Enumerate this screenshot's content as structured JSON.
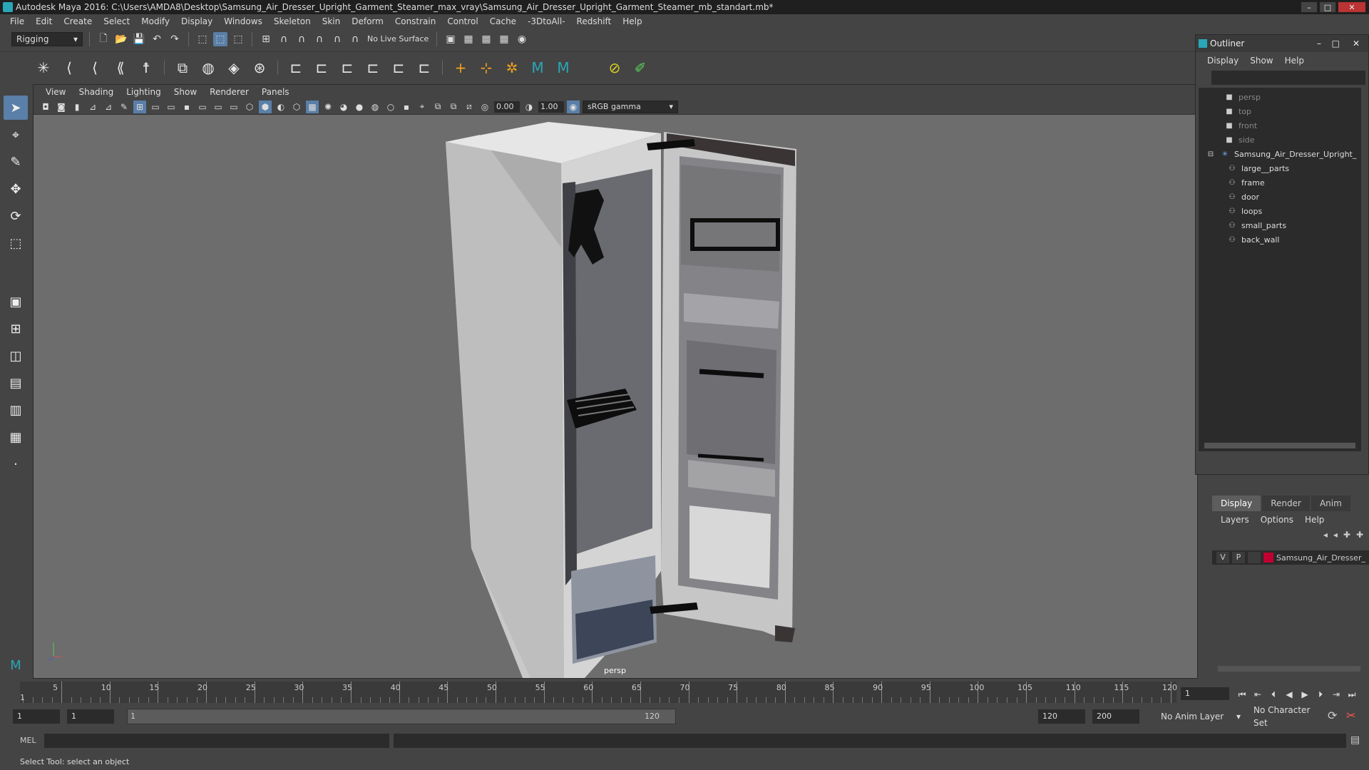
{
  "window": {
    "title": "Autodesk Maya 2016: C:\\Users\\AMDA8\\Desktop\\Samsung_Air_Dresser_Upright_Garment_Steamer_max_vray\\Samsung_Air_Dresser_Upright_Garment_Steamer_mb_standart.mb*"
  },
  "menubar": [
    "File",
    "Edit",
    "Create",
    "Select",
    "Modify",
    "Display",
    "Windows",
    "Skeleton",
    "Skin",
    "Deform",
    "Constrain",
    "Control",
    "Cache",
    "-3DtoAll-",
    "Redshift",
    "Help"
  ],
  "toolbar": {
    "mode": "Rigging",
    "live_surface": "No Live Surface"
  },
  "viewport": {
    "menu": [
      "View",
      "Shading",
      "Lighting",
      "Show",
      "Renderer",
      "Panels"
    ],
    "exposure": "0.00",
    "gamma": "1.00",
    "color_space": "sRGB gamma",
    "camera_label": "persp"
  },
  "outliner": {
    "title": "Outliner",
    "menu": [
      "Display",
      "Show",
      "Help"
    ],
    "cameras": [
      "persp",
      "top",
      "front",
      "side"
    ],
    "root": "Samsung_Air_Dresser_Upright_",
    "children": [
      "large__parts",
      "frame",
      "door",
      "loops",
      "small_parts",
      "back_wall"
    ]
  },
  "layers": {
    "tabs": [
      "Display",
      "Render",
      "Anim"
    ],
    "menu": [
      "Layers",
      "Options",
      "Help"
    ],
    "row": {
      "v": "V",
      "p": "P",
      "name": "Samsung_Air_Dresser_",
      "color": "#c00030"
    }
  },
  "timeline": {
    "ticks": [
      "5",
      "10",
      "15",
      "20",
      "25",
      "30",
      "35",
      "40",
      "45",
      "50",
      "55",
      "60",
      "65",
      "70",
      "75",
      "80",
      "85",
      "90",
      "95",
      "100",
      "105",
      "110",
      "115",
      "120"
    ],
    "start_label": "1",
    "current_frame": "1"
  },
  "range": {
    "start": "1",
    "anim_start": "1",
    "slider_start": "1",
    "slider_end": "120",
    "end": "120",
    "anim_end": "200",
    "anim_layer": "No Anim Layer",
    "character_set": "No Character Set"
  },
  "cmdline": {
    "label": "MEL"
  },
  "status": {
    "text": "Select Tool: select an object"
  }
}
